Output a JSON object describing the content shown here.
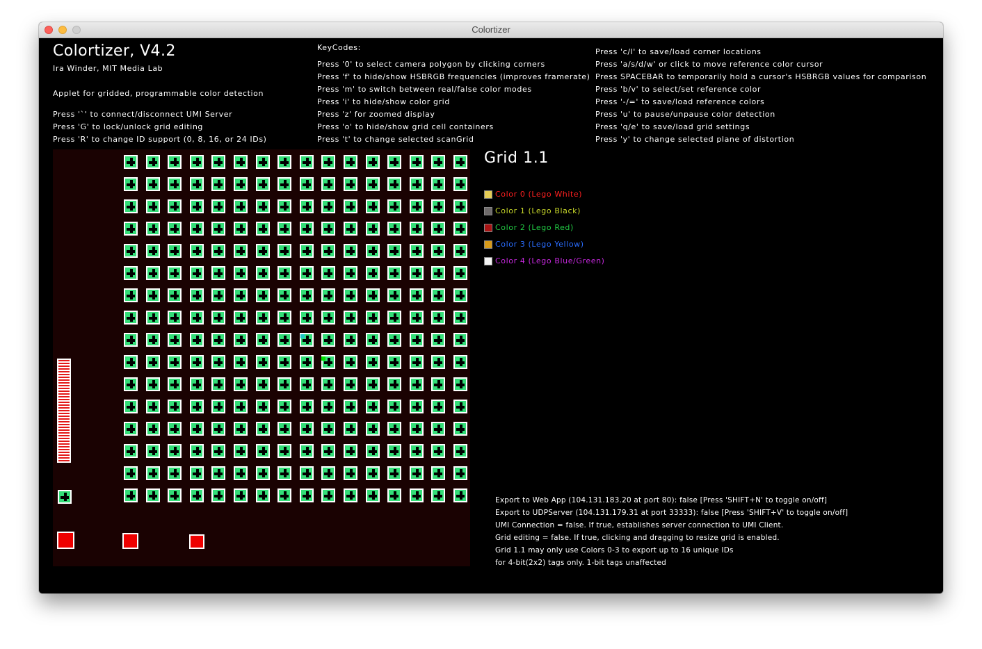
{
  "window": {
    "title": "Colortizer"
  },
  "header": {
    "title": "Colortizer, V4.2",
    "author": "Ira Winder, MIT Media Lab",
    "description": "Applet for gridded, programmable color detection",
    "left_keys": [
      "Press '`' to connect/disconnect UMI Server",
      "Press 'G' to lock/unlock grid editing",
      "Press 'R' to change ID support (0, 8, 16, or 24 IDs)"
    ],
    "keycodes_label": "KeyCodes:",
    "mid_keys": [
      "Press '0' to select camera polygon by clicking corners",
      "Press 'f' to hide/show HSBRGB frequencies (improves framerate)",
      "Press 'm' to switch between real/false color modes",
      "Press 'i' to hide/show color grid",
      "Press 'z' for zoomed display",
      "Press 'o' to hide/show grid cell containers",
      "Press 't' to change selected scanGrid"
    ],
    "right_keys": [
      "Press 'c/l' to save/load corner locations",
      "Press 'a/s/d/w' or click to move reference color cursor",
      "Press SPACEBAR to temporarily hold a cursor's HSBRGB values for comparison",
      "Press 'b/v' to select/set reference color",
      "Press '-/=' to save/load reference colors",
      "Press 'u' to pause/unpause color detection",
      "Press 'q/e' to save/load grid settings",
      "Press 'y' to change selected plane of distortion"
    ]
  },
  "grid_panel": {
    "title": "Grid 1.1",
    "legend": [
      {
        "swatch": "#e5cc55",
        "label": "Color 0  (Lego White)",
        "text_color": "#ff2020"
      },
      {
        "swatch": "#6e6a6a",
        "label": "Color 1  (Lego Black)",
        "text_color": "#c8d82a"
      },
      {
        "swatch": "#aa1414",
        "label": "Color 2  (Lego Red)",
        "text_color": "#22cc44"
      },
      {
        "swatch": "#d89a18",
        "label": "Color 3  (Lego Yellow)",
        "text_color": "#2a6dff"
      },
      {
        "swatch": "#f4f4f4",
        "label": "Color 4  (Lego Blue/Green)",
        "text_color": "#c829e0"
      }
    ]
  },
  "status": [
    "Export to Web App (104.131.183.20 at port 80): false [Press 'SHIFT+N' to toggle on/off]",
    "Export to UDPServer (104.131.179.31 at port 33333): false [Press 'SHIFT+V' to toggle on/off]",
    "UMI Connection = false. If true, establishes server connection to UMI Client.",
    "Grid editing = false. If true, clicking and dragging to resize grid is enabled.",
    "Grid 1.1 may only use Colors 0-3 to export up to 16 unique IDs",
    "for 4-bit(2x2) tags only.  1-bit tags unaffected"
  ],
  "scan_grid": {
    "rows": 16,
    "cols": 16,
    "cell_fill": "#33dd77",
    "video_background": "#1a0202"
  },
  "colors": {
    "background": "#000000",
    "text": "#ffffff",
    "accent_red": "#ee0000"
  }
}
